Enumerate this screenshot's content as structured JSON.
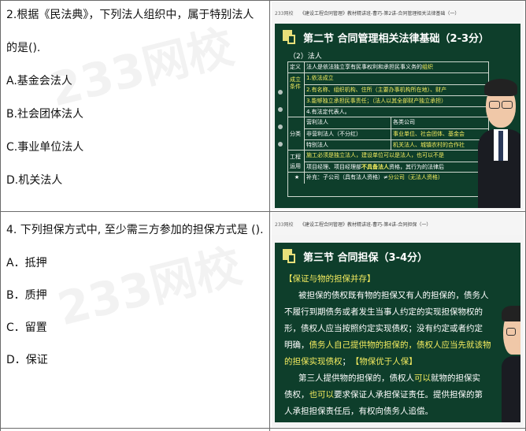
{
  "q1": {
    "stem_line1": "2.根据《民法典》，下列法人组织中，属于特别法人",
    "stem_line2": "的是().",
    "options": [
      "A.基金会法人",
      "B.社会团体法人",
      "C.事业单位法人",
      "D.机关法人"
    ]
  },
  "q2": {
    "stem": "4. 下列担保方式中, 至少需三方参加的担保方式是 ().",
    "options": [
      "A．抵押",
      "B．质押",
      "C．留置",
      "D．保证"
    ]
  },
  "watermark": "233网校",
  "video1": {
    "bar_logo": "233网校",
    "bar_text": "《建设工程合同管理》教材精讲班-曹巧-第2讲-合同管理相关法律基础（一）",
    "heading": "第二节  合同管理相关法律基础（2-3分）",
    "subheading": "（2）法人",
    "def_label": "定义",
    "def_text_pre": "法人是依法独立享有民事权利和承担民事义务的",
    "def_text_hl": "组织",
    "cond_label": "成立条件",
    "cond_items": [
      "1.依法成立",
      "2.有名称、组织机构、住所（主要办事机构所在地）、财产",
      "3.能够独立承担民事责任；（法人以其全部财产独立承担）",
      "4.有法定代表人。"
    ],
    "cls_label": "分类",
    "cls_rows": [
      [
        "营利法人",
        "各类公司"
      ],
      [
        "非营利法人（不分红）",
        "事业单位、社会团体、基金会"
      ],
      [
        "特别法人",
        "机关法人、城镇农村的合作社"
      ]
    ],
    "eng_label": "工程运用",
    "eng_line1": "施工必须是独立法人，建设单位可以是法人，也可以不是",
    "eng_line2_pre": "项目经理、项目经理部",
    "eng_line2_hl": "不具备法人",
    "eng_line2_post": "资格，其行为的法律后",
    "star": "★",
    "note_pre": "补充：子公司（具有法人资格）≠",
    "note_hl": "分公司（无法人资格）"
  },
  "video2": {
    "bar_logo": "233网校",
    "bar_text": "《建设工程合同管理》教材精讲班-曹巧-第4讲-合同担保（一）",
    "heading": "第三节  合同担保（3-4分）",
    "tag1": "【保证与物的担保并存】",
    "p1": [
      "被担保的债权既有物的担保又有人的担保的，债务人",
      "不履行到期债务或者发生当事人约定的实现担保物权的",
      "形，债权人应当按照约定实现债权；没有约定或者约定"
    ],
    "p1_l4_pre": "明确，",
    "p1_l4_hl": "债务人自己提供物的担保的，债权人应当先就该物",
    "p1_l5_hl": "的担保实现债权",
    "p1_l5_post": "；",
    "tag2": "【物保优于人保】",
    "p2_l1_pre": "第三人提供物的担保的，债权人",
    "p2_l1_hl": "可以",
    "p2_l1_post": "就物的担保实",
    "p2_l2_pre": "债权，",
    "p2_l2_hl": "也可以",
    "p2_l2_post": "要求保证人承担保证责任。提供担保的第",
    "p2_l3": "人承担担保责任后，有权向债务人追偿。"
  }
}
